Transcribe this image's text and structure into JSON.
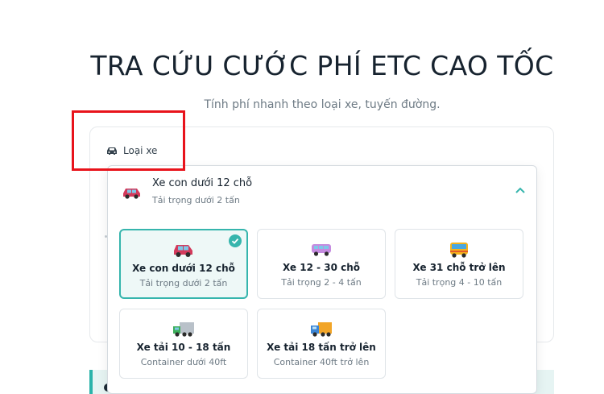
{
  "page": {
    "title": "TRA CỨU CƯỚC PHÍ ETC CAO TỐC",
    "subtitle": "Tính phí nhanh theo loại xe, tuyến đường."
  },
  "form": {
    "vehicle_label": "Loại xe"
  },
  "dropdown": {
    "selected": {
      "name": "Xe con dưới 12 chỗ",
      "sub": "Tải trọng dưới 2 tấn"
    },
    "options": [
      {
        "name": "Xe con dưới 12 chỗ",
        "sub": "Tải trọng dưới 2 tấn",
        "icon": "car-icon",
        "selected": true
      },
      {
        "name": "Xe 12 - 30 chỗ",
        "sub": "Tải trọng 2 - 4 tấn",
        "icon": "minibus-icon",
        "selected": false
      },
      {
        "name": "Xe 31 chỗ trở lên",
        "sub": "Tải trọng 4 - 10 tấn",
        "icon": "bus-icon",
        "selected": false
      },
      {
        "name": "Xe tải 10 - 18 tấn",
        "sub": "Container dưới 40ft",
        "icon": "truck-icon",
        "selected": false
      },
      {
        "name": "Xe tải 18 tấn trở lên",
        "sub": "Container 40ft trở lên",
        "icon": "heavy-truck-icon",
        "selected": false
      }
    ]
  },
  "colors": {
    "accent": "#36b5ad",
    "highlight": "#e8131b"
  }
}
